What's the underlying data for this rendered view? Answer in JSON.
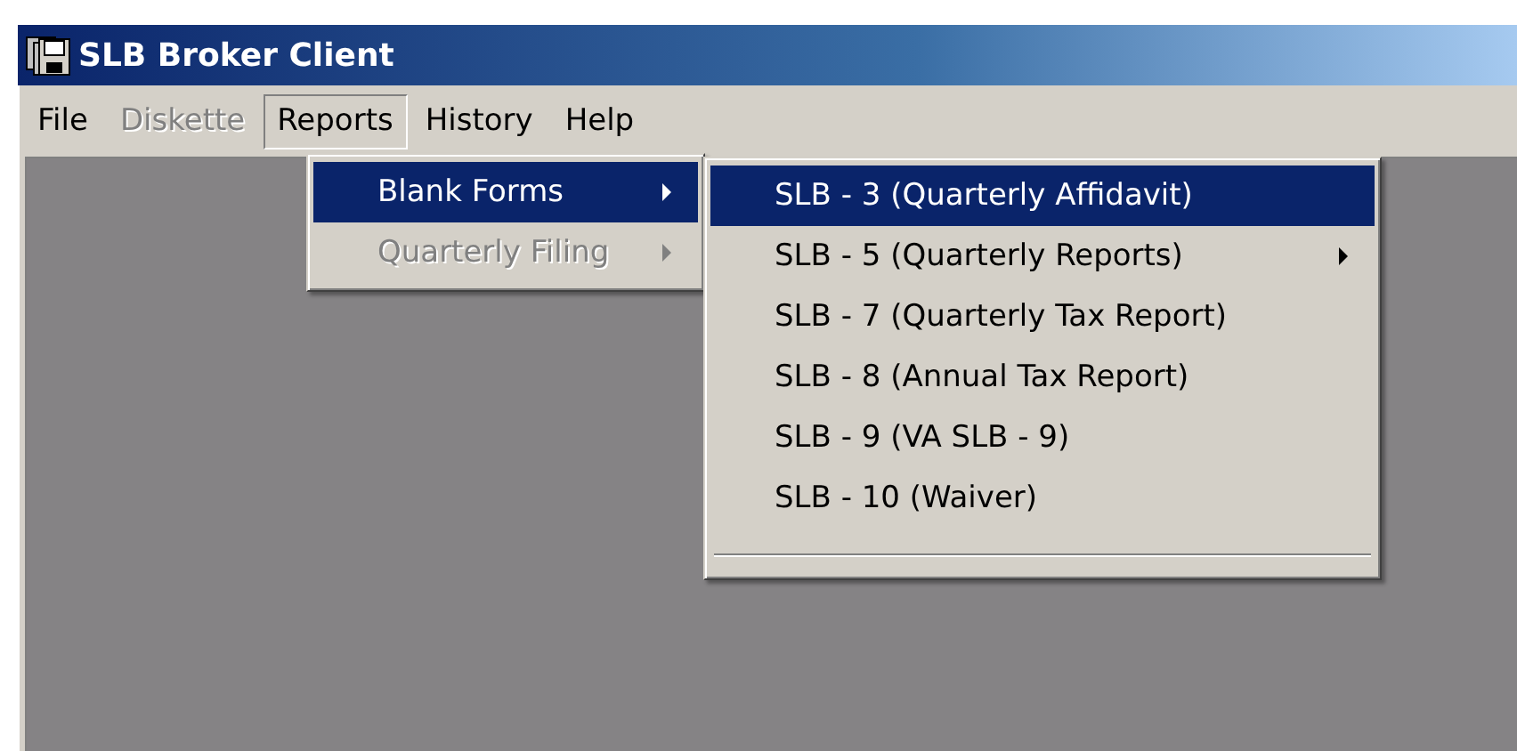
{
  "window": {
    "title": "SLB Broker Client"
  },
  "menu_bar": [
    {
      "label": "File",
      "disabled": false,
      "selected": false
    },
    {
      "label": "Diskette",
      "disabled": true,
      "selected": false
    },
    {
      "label": "Reports",
      "disabled": false,
      "selected": true
    },
    {
      "label": "History",
      "disabled": false,
      "selected": false
    },
    {
      "label": "Help",
      "disabled": false,
      "selected": false
    }
  ],
  "reports_menu": [
    {
      "kind": "item",
      "label": "Blank Forms",
      "selected": true,
      "disabled": false,
      "has_submenu": true
    },
    {
      "kind": "item",
      "label": "Quarterly Filing",
      "selected": false,
      "disabled": true,
      "has_submenu": true
    }
  ],
  "blank_forms_menu": [
    {
      "kind": "item",
      "label": "SLB - 3 (Quarterly Affidavit)",
      "selected": true,
      "disabled": false,
      "has_submenu": false
    },
    {
      "kind": "item",
      "label": "SLB - 5 (Quarterly Reports)",
      "selected": false,
      "disabled": false,
      "has_submenu": true
    },
    {
      "kind": "item",
      "label": "SLB - 7 (Quarterly Tax Report)",
      "selected": false,
      "disabled": false,
      "has_submenu": false
    },
    {
      "kind": "item",
      "label": "SLB - 8 (Annual Tax Report)",
      "selected": false,
      "disabled": false,
      "has_submenu": false
    },
    {
      "kind": "item",
      "label": "SLB - 9 (VA SLB - 9)",
      "selected": false,
      "disabled": false,
      "has_submenu": false
    },
    {
      "kind": "item",
      "label": "SLB - 10 (Waiver)",
      "selected": false,
      "disabled": false,
      "has_submenu": false
    },
    {
      "kind": "separator"
    }
  ]
}
